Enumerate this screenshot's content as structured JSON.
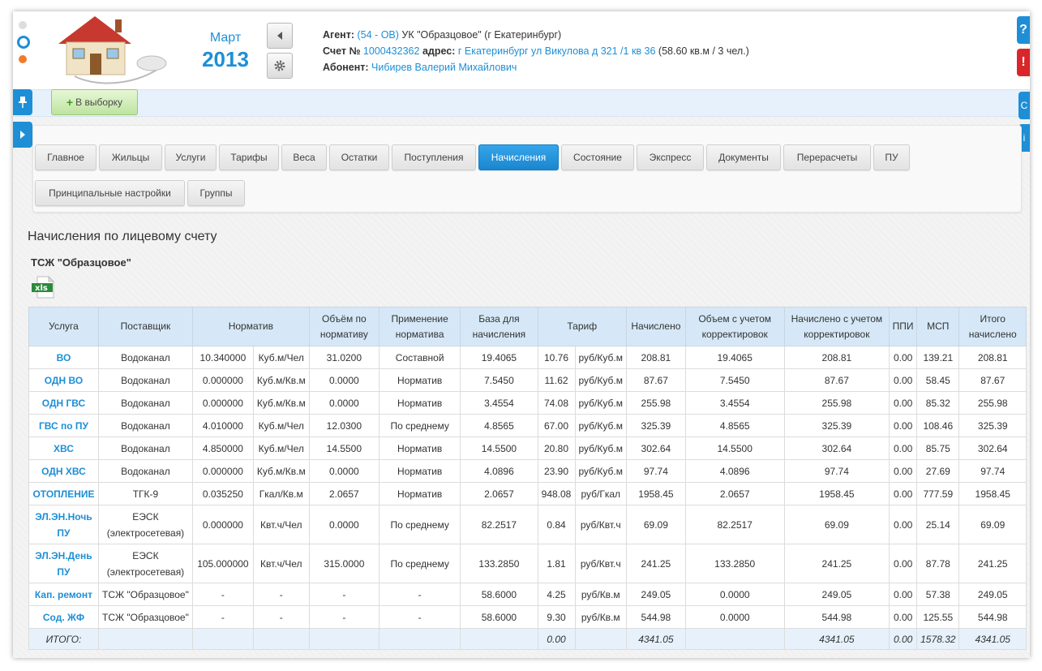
{
  "header": {
    "month": "Март",
    "year": "2013",
    "agent_label": "Агент:",
    "agent_link": "(54 - ОВ)",
    "agent_text": " УК \"Образцовое\" (г Екатеринбург)",
    "account_label": "Счет №",
    "account_number": "1000432362",
    "address_label": "адрес:",
    "address_link": "г Екатеринбург ул Викулова д 321 /1 кв 36",
    "address_extra": " (58.60 кв.м / 3 чел.)",
    "subscriber_label": "Абонент:",
    "subscriber_name": "Чибирев Валерий Михайлович"
  },
  "toolbar": {
    "add_label": "В выборку"
  },
  "side": {
    "help_label": "?",
    "alert_label": "!",
    "right_tab_1": "С",
    "right_tab_2": "i"
  },
  "tabs": [
    "Главное",
    "Жильцы",
    "Услуги",
    "Тарифы",
    "Веса",
    "Остатки",
    "Поступления",
    "Начисления",
    "Состояние",
    "Экспресс",
    "Документы",
    "Перерасчеты",
    "ПУ",
    "Принципальные настройки",
    "Группы"
  ],
  "active_tab": "Начисления",
  "page": {
    "title": "Начисления по лицевому счету",
    "org": "ТСЖ \"Образцовое\"",
    "xls_label": "xls"
  },
  "table": {
    "headers": [
      "Услуга",
      "Поставщик",
      "Норматив",
      "Объём по нормативу",
      "Применение норматива",
      "База для начисления",
      "Тариф",
      "Начислено",
      "Объем с учетом корректировок",
      "Начислено с учетом корректировок",
      "ППИ",
      "МСП",
      "Итого начислено"
    ],
    "rows": [
      [
        "ВО",
        "Водоканал",
        "10.340000",
        "Куб.м/Чел",
        "31.0200",
        "Составной",
        "19.4065",
        "10.76",
        "руб/Куб.м",
        "208.81",
        "19.4065",
        "208.81",
        "0.00",
        "139.21",
        "208.81"
      ],
      [
        "ОДН ВО",
        "Водоканал",
        "0.000000",
        "Куб.м/Кв.м",
        "0.0000",
        "Норматив",
        "7.5450",
        "11.62",
        "руб/Куб.м",
        "87.67",
        "7.5450",
        "87.67",
        "0.00",
        "58.45",
        "87.67"
      ],
      [
        "ОДН ГВС",
        "Водоканал",
        "0.000000",
        "Куб.м/Кв.м",
        "0.0000",
        "Норматив",
        "3.4554",
        "74.08",
        "руб/Куб.м",
        "255.98",
        "3.4554",
        "255.98",
        "0.00",
        "85.32",
        "255.98"
      ],
      [
        "ГВС по ПУ",
        "Водоканал",
        "4.010000",
        "Куб.м/Чел",
        "12.0300",
        "По среднему",
        "4.8565",
        "67.00",
        "руб/Куб.м",
        "325.39",
        "4.8565",
        "325.39",
        "0.00",
        "108.46",
        "325.39"
      ],
      [
        "ХВС",
        "Водоканал",
        "4.850000",
        "Куб.м/Чел",
        "14.5500",
        "Норматив",
        "14.5500",
        "20.80",
        "руб/Куб.м",
        "302.64",
        "14.5500",
        "302.64",
        "0.00",
        "85.75",
        "302.64"
      ],
      [
        "ОДН ХВС",
        "Водоканал",
        "0.000000",
        "Куб.м/Кв.м",
        "0.0000",
        "Норматив",
        "4.0896",
        "23.90",
        "руб/Куб.м",
        "97.74",
        "4.0896",
        "97.74",
        "0.00",
        "27.69",
        "97.74"
      ],
      [
        "ОТОПЛЕНИЕ",
        "ТГК-9",
        "0.035250",
        "Гкал/Кв.м",
        "2.0657",
        "Норматив",
        "2.0657",
        "948.08",
        "руб/Гкал",
        "1958.45",
        "2.0657",
        "1958.45",
        "0.00",
        "777.59",
        "1958.45"
      ],
      [
        "ЭЛ.ЭН.Ночь ПУ",
        "ЕЭСК (электросетевая)",
        "0.000000",
        "Квт.ч/Чел",
        "0.0000",
        "По среднему",
        "82.2517",
        "0.84",
        "руб/Квт.ч",
        "69.09",
        "82.2517",
        "69.09",
        "0.00",
        "25.14",
        "69.09"
      ],
      [
        "ЭЛ.ЭН.День ПУ",
        "ЕЭСК (электросетевая)",
        "105.000000",
        "Квт.ч/Чел",
        "315.0000",
        "По среднему",
        "133.2850",
        "1.81",
        "руб/Квт.ч",
        "241.25",
        "133.2850",
        "241.25",
        "0.00",
        "87.78",
        "241.25"
      ],
      [
        "Кап. ремонт",
        "ТСЖ \"Образцовое\"",
        "-",
        "-",
        "-",
        "-",
        "58.6000",
        "4.25",
        "руб/Кв.м",
        "249.05",
        "0.0000",
        "249.05",
        "0.00",
        "57.38",
        "249.05"
      ],
      [
        "Сод. ЖФ",
        "ТСЖ \"Образцовое\"",
        "-",
        "-",
        "-",
        "-",
        "58.6000",
        "9.30",
        "руб/Кв.м",
        "544.98",
        "0.0000",
        "544.98",
        "0.00",
        "125.55",
        "544.98"
      ]
    ],
    "total": {
      "label": "ИТОГО:",
      "tariff": "0.00",
      "charged": "4341.05",
      "charged_corr": "4341.05",
      "ppi": "0.00",
      "msp": "1578.32",
      "grand": "4341.05"
    }
  },
  "colors": {
    "accent": "#1e8fd6",
    "active_tab": "#1a86cf",
    "header_bg": "#d6e8f7"
  }
}
